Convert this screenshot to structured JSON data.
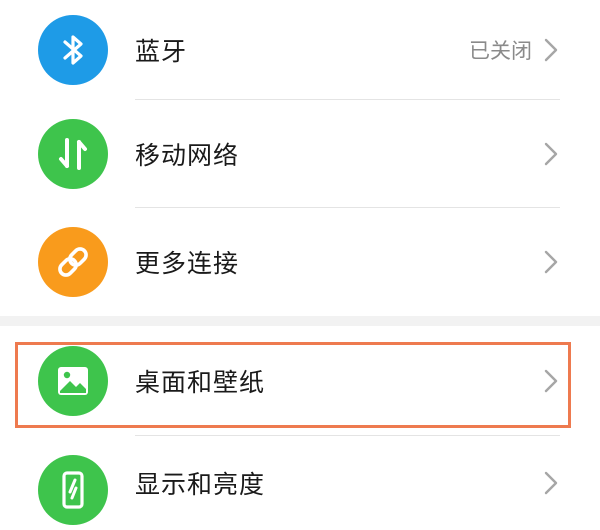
{
  "settings": {
    "items": [
      {
        "label": "蓝牙",
        "value": "已关闭",
        "icon": "bluetooth-icon",
        "color": "#1e9be7"
      },
      {
        "label": "移动网络",
        "value": "",
        "icon": "mobile-data-icon",
        "color": "#3ec44c"
      },
      {
        "label": "更多连接",
        "value": "",
        "icon": "link-icon",
        "color": "#f99b1c"
      },
      {
        "label": "桌面和壁纸",
        "value": "",
        "icon": "image-icon",
        "color": "#3ec44c"
      },
      {
        "label": "显示和亮度",
        "value": "",
        "icon": "phone-display-icon",
        "color": "#3ec44c"
      }
    ]
  },
  "highlight": {
    "target": "桌面和壁纸",
    "color": "#ee7a4f"
  }
}
